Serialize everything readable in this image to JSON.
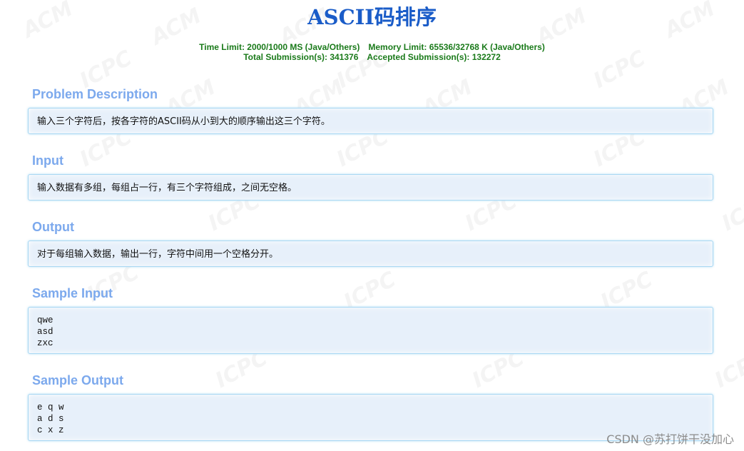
{
  "problem": {
    "title": "ASCII码排序",
    "time_limit": "Time Limit: 2000/1000 MS (Java/Others)",
    "memory_limit": "Memory Limit: 65536/32768 K (Java/Others)",
    "total_submissions": "Total Submission(s): 341376",
    "accepted_submissions": "Accepted Submission(s): 132272"
  },
  "sections": {
    "description": {
      "heading": "Problem Description",
      "body": "输入三个字符后，按各字符的ASCII码从小到大的顺序输出这三个字符。"
    },
    "input": {
      "heading": "Input",
      "body": "输入数据有多组，每组占一行，有三个字符组成，之间无空格。"
    },
    "output": {
      "heading": "Output",
      "body": "对于每组输入数据，输出一行，字符中间用一个空格分开。"
    },
    "sample_input": {
      "heading": "Sample Input",
      "body": "qwe\nasd\nzxc"
    },
    "sample_output": {
      "heading": "Sample Output",
      "body": "e q w\na d s\nc x z"
    }
  },
  "watermark": {
    "csdn_credit": "CSDN @苏打饼干没加心",
    "background_words": [
      "ACM",
      "ICPC"
    ]
  },
  "colors": {
    "title": "#1a5cc8",
    "limits": "#1a7a1a",
    "section_heading": "#7ca9ed",
    "panel_background": "#e7f0fa",
    "panel_border": "#a9d8f3"
  }
}
